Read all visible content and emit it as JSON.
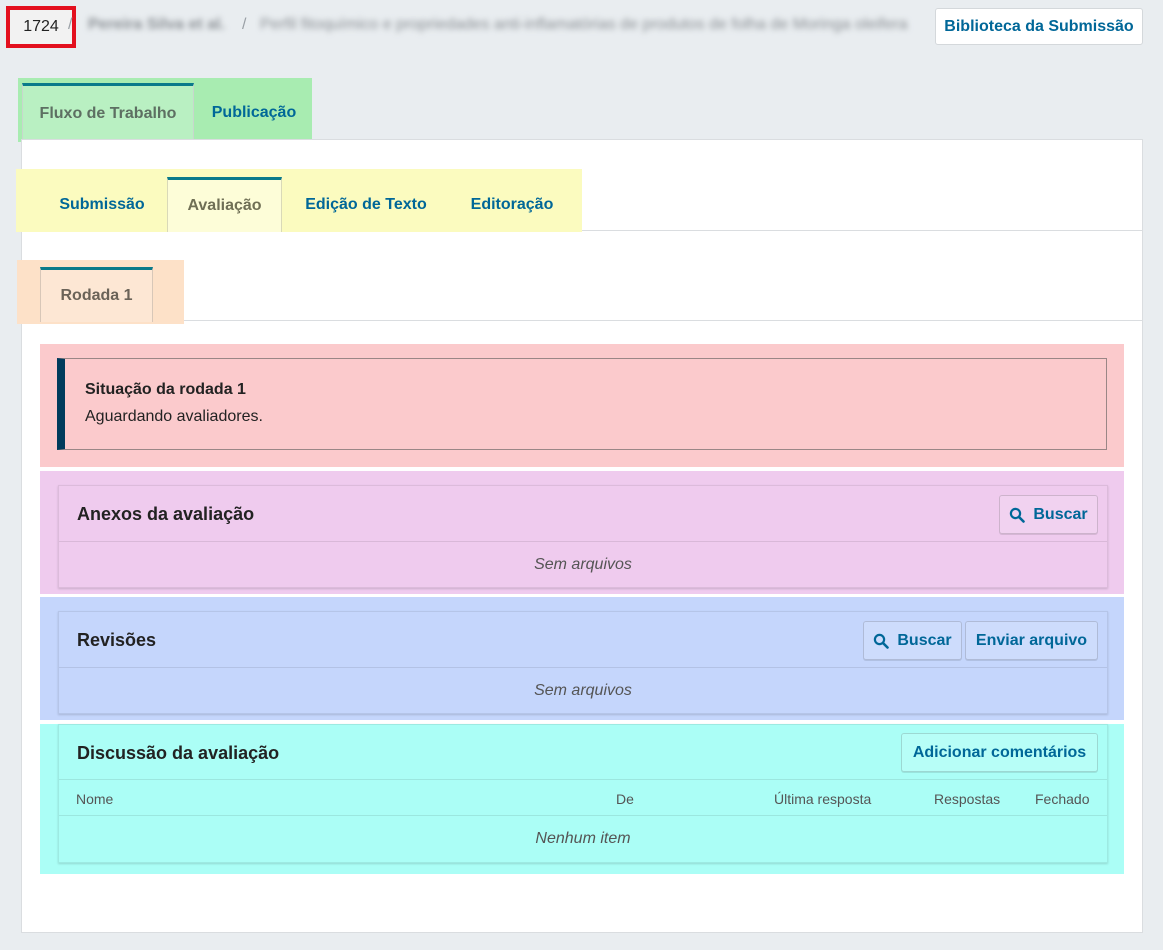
{
  "header": {
    "submission_id": "1724",
    "separator": "/",
    "authors_blurred": "Pereira Silva et al.",
    "title_blurred": "Perfil fitoquímico e propriedades anti-inflamatórias de produtos de folha de Moringa oleifera",
    "library_button": "Biblioteca da Submissão"
  },
  "main_tabs": [
    {
      "label": "Fluxo de Trabalho"
    },
    {
      "label": "Publicação"
    }
  ],
  "stage_tabs": [
    {
      "label": "Submissão"
    },
    {
      "label": "Avaliação"
    },
    {
      "label": "Edição de Texto"
    },
    {
      "label": "Editoração"
    }
  ],
  "round_tabs": [
    {
      "label": "Rodada 1"
    }
  ],
  "status": {
    "title": "Situação da rodada 1",
    "text": "Aguardando avaliadores."
  },
  "attachments": {
    "title": "Anexos da avaliação",
    "search_button": "Buscar",
    "empty": "Sem arquivos"
  },
  "revisions": {
    "title": "Revisões",
    "search_button": "Buscar",
    "upload_button": "Enviar arquivo",
    "empty": "Sem arquivos"
  },
  "discussion": {
    "title": "Discussão da avaliação",
    "add_button": "Adicionar comentários",
    "columns": [
      "Nome",
      "De",
      "Última resposta",
      "Respostas",
      "Fechado"
    ],
    "empty": "Nenhum item"
  },
  "colors": {
    "link": "#006798",
    "status_accent": "#003b5c",
    "highlight_red": "#e3101e"
  }
}
